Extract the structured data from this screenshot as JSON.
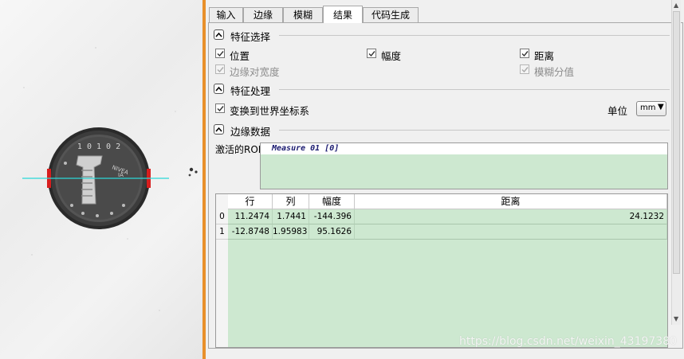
{
  "tabs": [
    {
      "label": "输入",
      "active": false
    },
    {
      "label": "边缘",
      "active": false
    },
    {
      "label": "模糊",
      "active": false
    },
    {
      "label": "结果",
      "active": true
    },
    {
      "label": "代码生成",
      "active": false
    }
  ],
  "feature_select": {
    "title": "特征选择",
    "position": {
      "label": "位置",
      "checked": true
    },
    "amplitude": {
      "label": "幅度",
      "checked": true
    },
    "distance": {
      "label": "距离",
      "checked": true
    },
    "edge_width": {
      "label": "边缘对宽度",
      "checked": true,
      "disabled": true
    },
    "blur_score": {
      "label": "模糊分值",
      "checked": true,
      "disabled": true
    }
  },
  "feature_process": {
    "title": "特征处理",
    "transform": {
      "label": "变换到世界坐标系",
      "checked": true
    },
    "unit_label": "单位",
    "unit_value": "mm"
  },
  "edge_data": {
    "title": "边缘数据",
    "roi_label": "激活的ROI",
    "roi_value": "Measure 01 [0]",
    "columns": [
      "行",
      "列",
      "幅度",
      "距离"
    ],
    "rows": [
      {
        "index": "0",
        "row": "11.2474",
        "col": "1.7441",
        "amp": "-144.396",
        "dist": "24.1232"
      },
      {
        "index": "1",
        "row": "-12.8748",
        "col": "1.95983",
        "amp": "95.1626",
        "dist": ""
      }
    ]
  },
  "coin": {
    "top_text": "1 0 1 0 2",
    "brand": "NIVEA",
    "sub": "IA"
  },
  "watermark": "https://blog.csdn.net/weixin_43197380",
  "colors": {
    "accent_orange": "#e8902b",
    "table_green": "#cde8d0",
    "measure_line": "#2ad8d8",
    "edge_red": "#d81e1e"
  }
}
